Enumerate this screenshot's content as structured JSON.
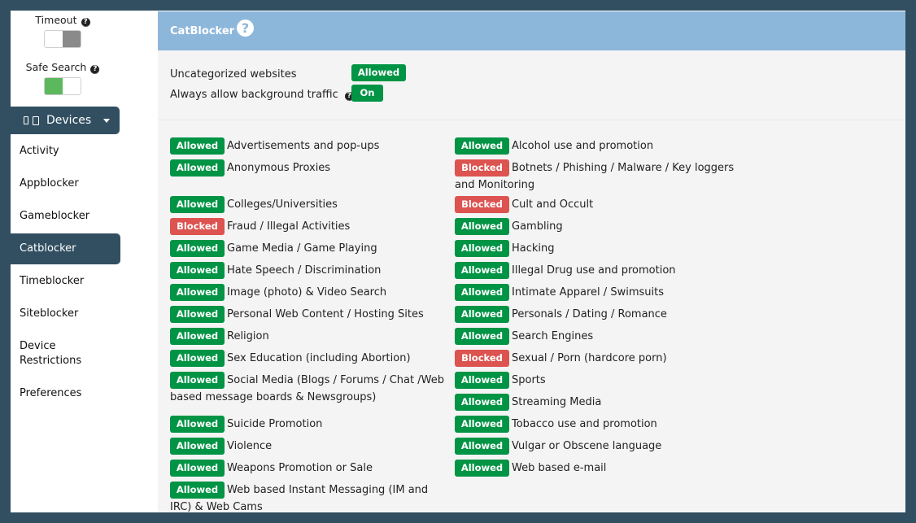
{
  "sidebar": {
    "timeout": {
      "label": "Timeout",
      "help": "?",
      "state": "off"
    },
    "safe_search": {
      "label": "Safe Search",
      "help": "?",
      "state": "on"
    },
    "devices_button": {
      "label": "Devices"
    },
    "nav_items": [
      {
        "label": "Activity",
        "active": false
      },
      {
        "label": "Appblocker",
        "active": false
      },
      {
        "label": "Gameblocker",
        "active": false
      },
      {
        "label": "Catblocker",
        "active": true
      },
      {
        "label": "Timeblocker",
        "active": false
      },
      {
        "label": "Siteblocker",
        "active": false
      },
      {
        "label": "Device Restrictions",
        "active": false
      },
      {
        "label": "Preferences",
        "active": false
      }
    ]
  },
  "panel": {
    "title": "CatBlocker",
    "help": "?",
    "uncategorized": {
      "label": "Uncategorized websites",
      "value": "Allowed"
    },
    "background_traffic": {
      "label": "Always allow background traffic",
      "help": "?",
      "value": "On"
    },
    "colors": {
      "allowed": "#029445",
      "blocked": "#dc5350",
      "header": "#8db7da",
      "frame": "#324f61"
    }
  },
  "categories_left": [
    {
      "status": "Allowed",
      "name": "Advertisements and pop-ups"
    },
    {
      "status": "Allowed",
      "name": "Anonymous Proxies"
    },
    {
      "status": "Allowed",
      "name": "Colleges/Universities"
    },
    {
      "status": "Blocked",
      "name": "Fraud / Illegal Activities"
    },
    {
      "status": "Allowed",
      "name": "Game Media / Game Playing"
    },
    {
      "status": "Allowed",
      "name": "Hate Speech / Discrimination"
    },
    {
      "status": "Allowed",
      "name": "Image (photo) & Video Search"
    },
    {
      "status": "Allowed",
      "name": "Personal Web Content / Hosting Sites"
    },
    {
      "status": "Allowed",
      "name": "Religion"
    },
    {
      "status": "Allowed",
      "name": "Sex Education (including Abortion)"
    },
    {
      "status": "Allowed",
      "name": "Social Media (Blogs / Forums / Chat /Web based message boards & Newsgroups)"
    },
    {
      "status": "Allowed",
      "name": "Suicide Promotion"
    },
    {
      "status": "Allowed",
      "name": "Violence"
    },
    {
      "status": "Allowed",
      "name": "Weapons Promotion or Sale"
    },
    {
      "status": "Allowed",
      "name": "Web based Instant Messaging (IM and IRC) & Web Cams"
    }
  ],
  "categories_right": [
    {
      "status": "Allowed",
      "name": "Alcohol use and promotion"
    },
    {
      "status": "Blocked",
      "name": "Botnets / Phishing / Malware / Key loggers and Monitoring"
    },
    {
      "status": "Blocked",
      "name": "Cult and Occult"
    },
    {
      "status": "Allowed",
      "name": "Gambling"
    },
    {
      "status": "Allowed",
      "name": "Hacking"
    },
    {
      "status": "Allowed",
      "name": "Illegal Drug use and promotion"
    },
    {
      "status": "Allowed",
      "name": "Intimate Apparel / Swimsuits"
    },
    {
      "status": "Allowed",
      "name": "Personals / Dating / Romance"
    },
    {
      "status": "Allowed",
      "name": "Search Engines"
    },
    {
      "status": "Blocked",
      "name": "Sexual / Porn (hardcore porn)"
    },
    {
      "status": "Allowed",
      "name": "Sports"
    },
    {
      "status": "Allowed",
      "name": "Streaming Media"
    },
    {
      "status": "Allowed",
      "name": "Tobacco use and promotion"
    },
    {
      "status": "Allowed",
      "name": "Vulgar or Obscene language"
    },
    {
      "status": "Allowed",
      "name": "Web based e-mail"
    }
  ]
}
